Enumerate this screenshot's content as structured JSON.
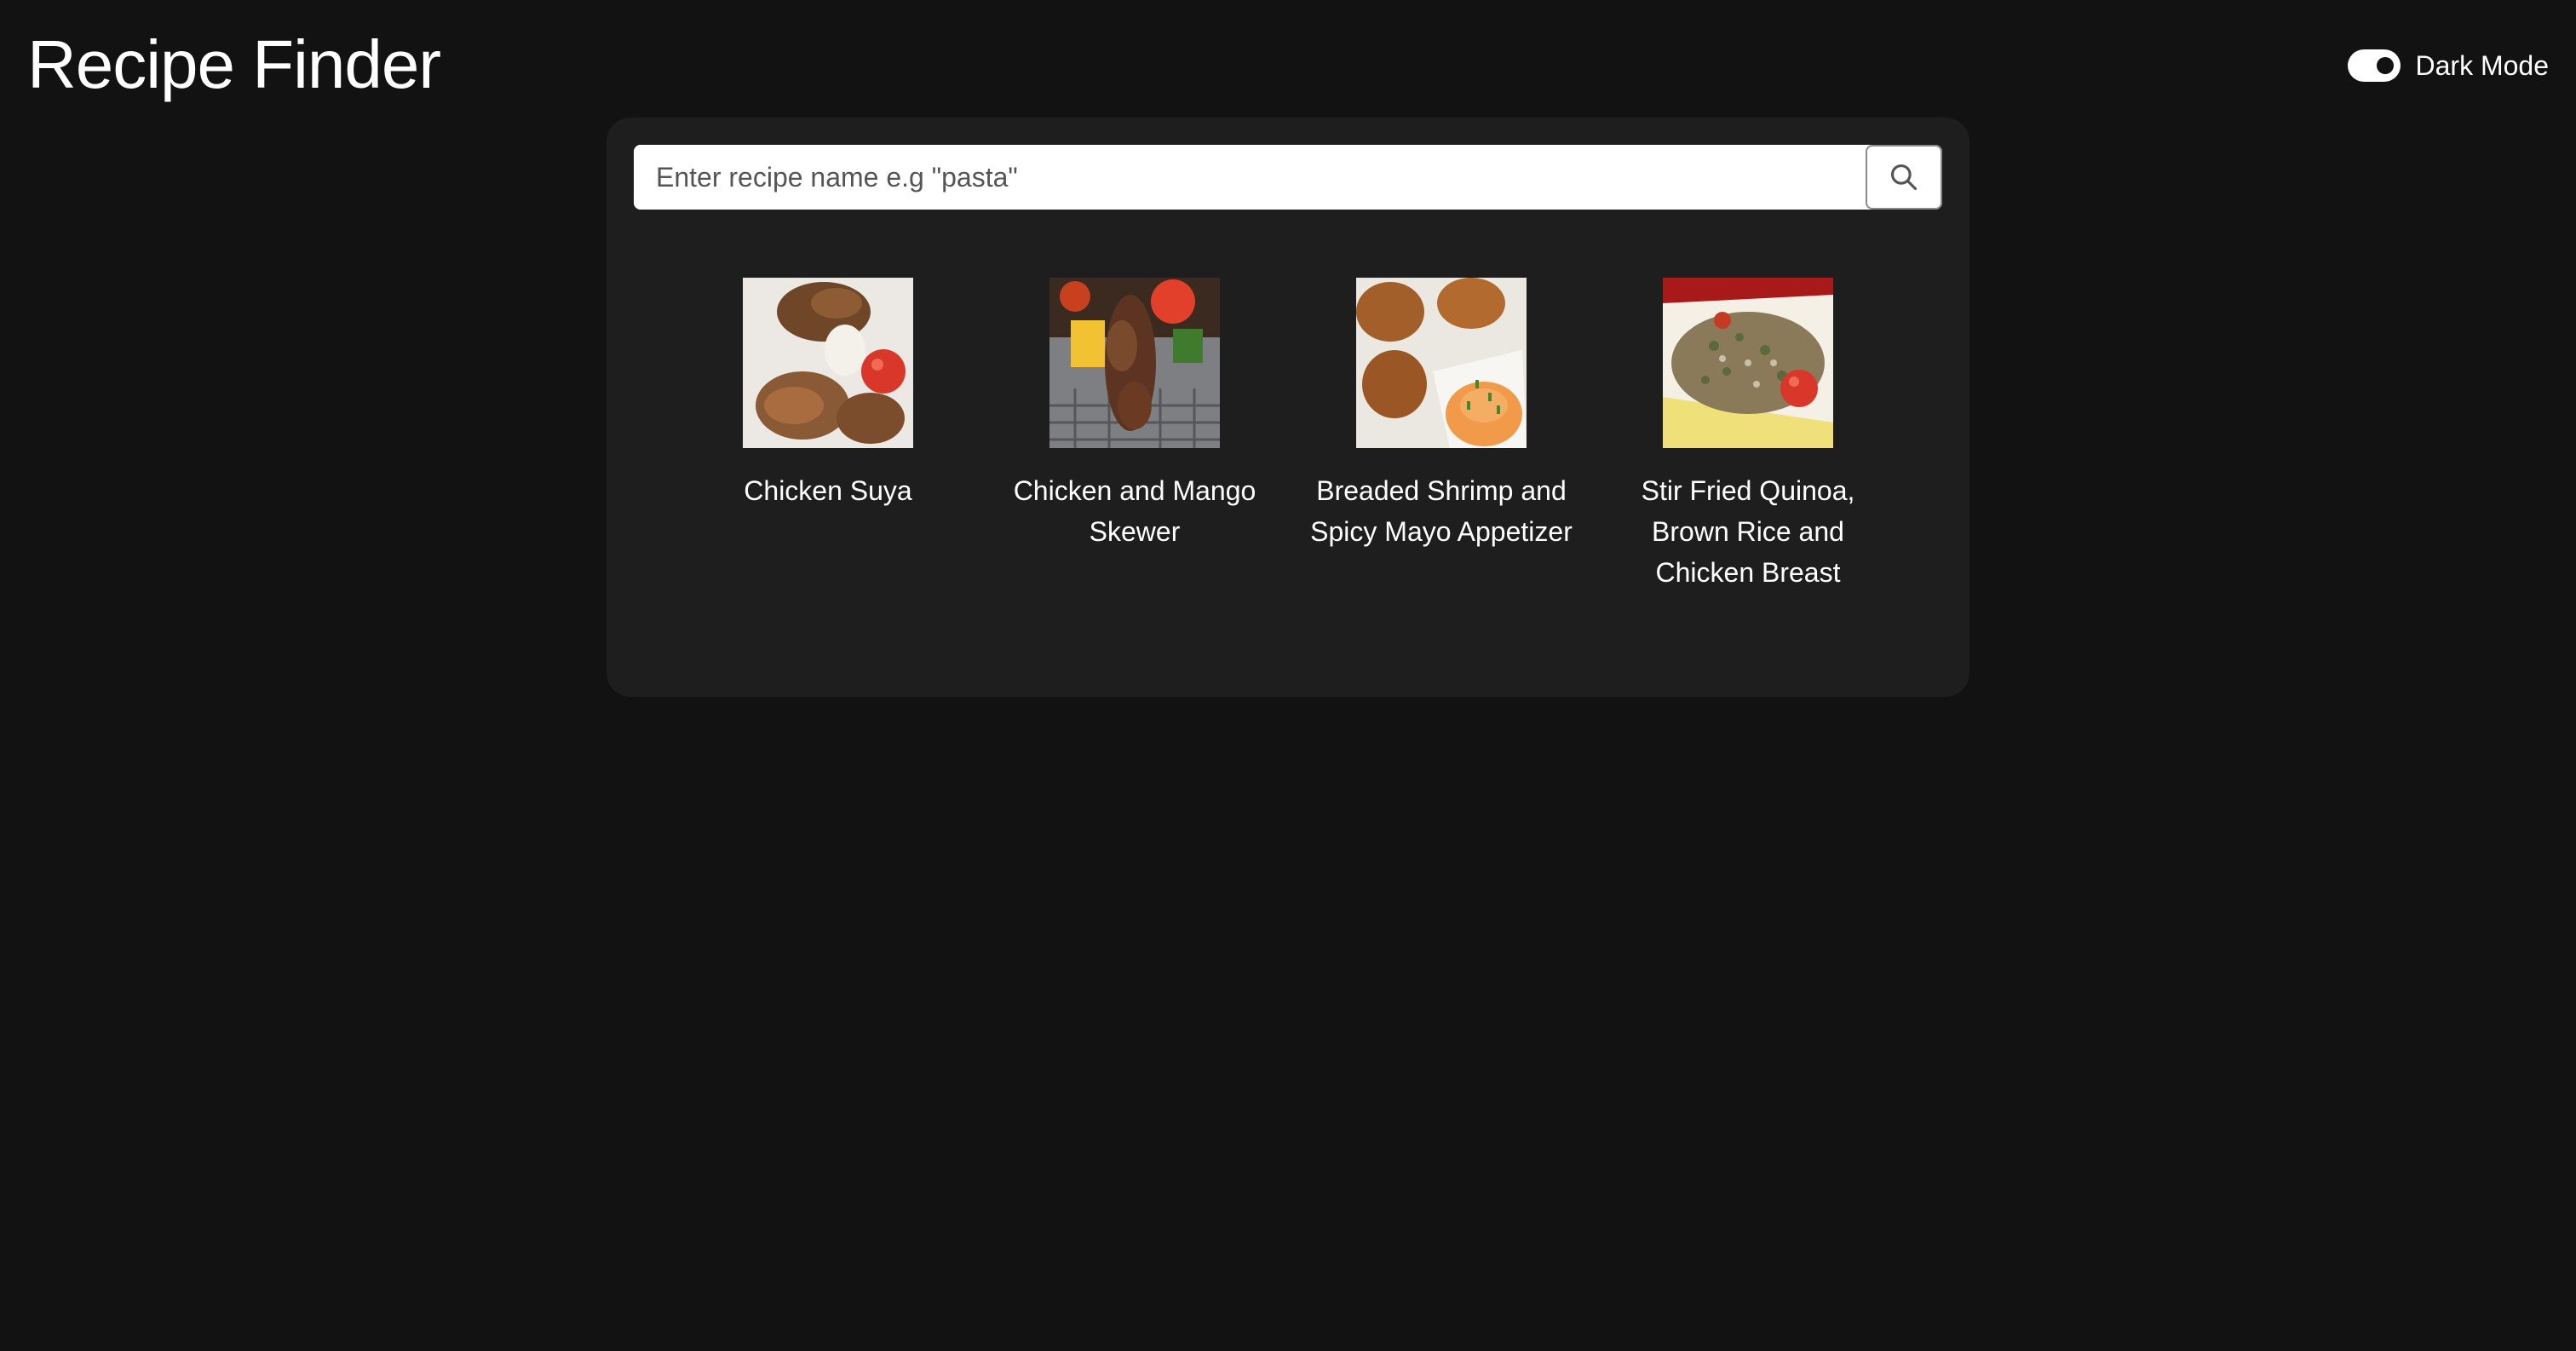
{
  "header": {
    "title": "Recipe Finder",
    "theme_toggle": {
      "label": "Dark Mode",
      "enabled": true
    }
  },
  "search": {
    "placeholder": "Enter recipe name e.g \"pasta\"",
    "value": "",
    "button_icon": "search-icon"
  },
  "recipes": [
    {
      "name": "Chicken Suya",
      "image": "grilled chicken with tomato and onion"
    },
    {
      "name": "Chicken and Mango Skewer",
      "image": "grilled skewers with peppers and tomato"
    },
    {
      "name": "Breaded Shrimp and Spicy Mayo Appetizer",
      "image": "fried shrimp with orange dipping sauce"
    },
    {
      "name": "Stir Fried Quinoa, Brown Rice and Chicken Breast",
      "image": "quinoa salad with tomato in a dish"
    }
  ],
  "colors": {
    "background": "#121212",
    "panel": "#1e1e1e",
    "text": "#ffffff"
  }
}
